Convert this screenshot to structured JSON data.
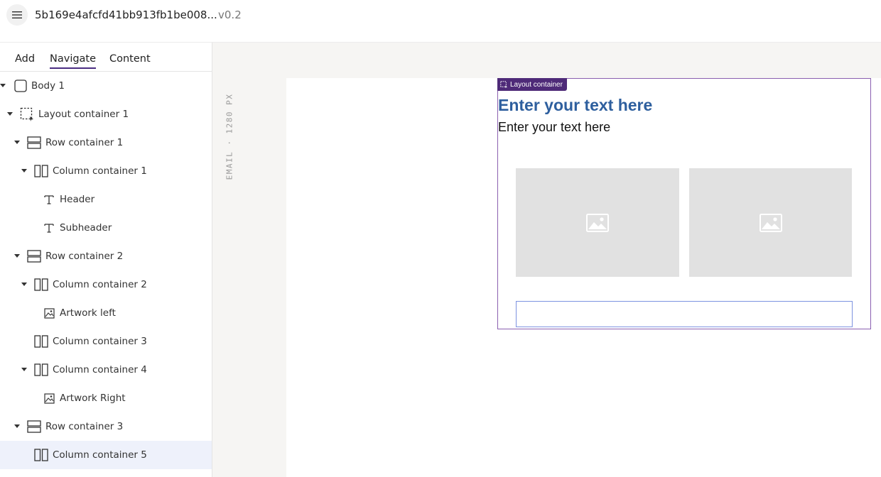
{
  "app": {
    "document_title": "5b169e4afcfd41bb913fb1be008...",
    "version": "v0.2",
    "menu_icon": "hamburger-menu-icon"
  },
  "sidebar": {
    "tabs": [
      {
        "label": "Add",
        "active": false
      },
      {
        "label": "Navigate",
        "active": true
      },
      {
        "label": "Content",
        "active": false
      }
    ],
    "tree": [
      {
        "label": "Body 1",
        "icon": "body-square-icon",
        "expanded": true,
        "level": 0
      },
      {
        "label": "Layout container 1",
        "icon": "layout-container-icon",
        "expanded": true,
        "level": 1
      },
      {
        "label": "Row container 1",
        "icon": "row-container-icon",
        "expanded": true,
        "level": 2
      },
      {
        "label": "Column container 1",
        "icon": "column-container-icon",
        "expanded": true,
        "level": 3
      },
      {
        "label": "Header",
        "icon": "text-icon",
        "level": 4
      },
      {
        "label": "Subheader",
        "icon": "text-icon",
        "level": 4
      },
      {
        "label": "Row container 2",
        "icon": "row-container-icon",
        "expanded": true,
        "level": 2
      },
      {
        "label": "Column container 2",
        "icon": "column-container-icon",
        "expanded": true,
        "level": 3
      },
      {
        "label": "Artwork left",
        "icon": "image-icon",
        "level": 4
      },
      {
        "label": "Column container 3",
        "icon": "column-container-icon",
        "level": 3
      },
      {
        "label": "Column container 4",
        "icon": "column-container-icon",
        "expanded": true,
        "level": 3
      },
      {
        "label": "Artwork Right",
        "icon": "image-icon",
        "level": 4
      },
      {
        "label": "Row container 3",
        "icon": "row-container-icon",
        "expanded": true,
        "level": 2
      },
      {
        "label": "Column container 5",
        "icon": "column-container-icon",
        "level": 3,
        "selected": true
      }
    ]
  },
  "canvas": {
    "viewport_label": "EMAIL · 1280 PX",
    "layout_tag": "Layout container",
    "header_text": "Enter your text here",
    "subheader_text": "Enter your text here",
    "artwork_icon": "image-placeholder-icon"
  },
  "colors": {
    "accent": "#4e2a78",
    "header_text": "#2e5f9e",
    "selected_row": "#eef1fb",
    "canvas_bg": "#f6f5f3",
    "placeholder": "#e1e1e1"
  }
}
